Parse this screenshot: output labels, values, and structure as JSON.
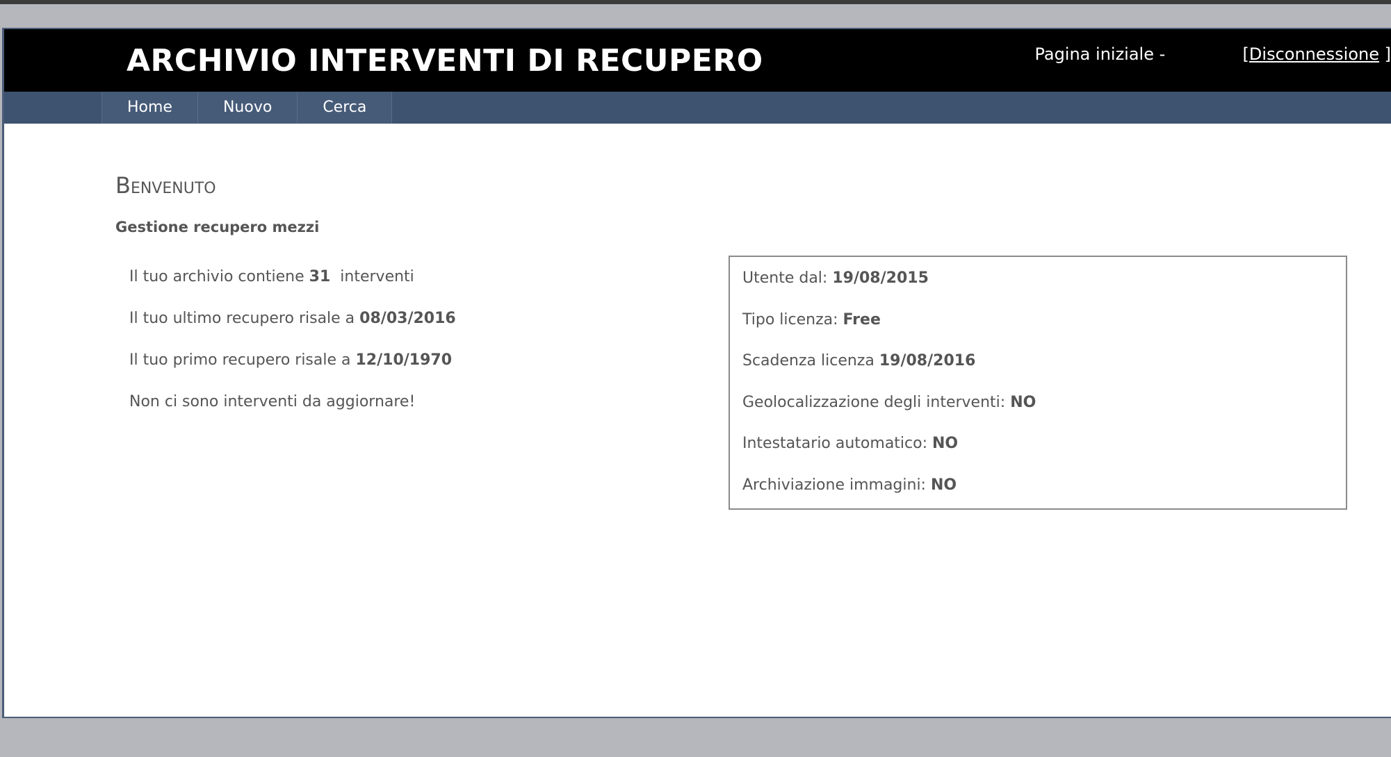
{
  "header": {
    "title": "ARCHIVIO INTERVENTI DI RECUPERO",
    "home_label": "Pagina iniziale -",
    "logout_open": "[",
    "logout_label": "Disconnessione",
    "logout_close": "]"
  },
  "menu": {
    "items": [
      {
        "label": "Home"
      },
      {
        "label": "Nuovo"
      },
      {
        "label": "Cerca"
      }
    ]
  },
  "main": {
    "welcome": "Benvenuto",
    "subtitle": "Gestione recupero mezzi",
    "stats": {
      "archive_prefix": "Il tuo archivio contiene",
      "archive_count": "31",
      "archive_suffix": "interventi",
      "last_prefix": "Il tuo ultimo recupero risale a",
      "last_date": "08/03/2016",
      "first_prefix": "Il tuo primo recupero risale a",
      "first_date": "12/10/1970",
      "no_updates": "Non ci sono interventi da aggiornare!"
    },
    "license": {
      "user_since_label": "Utente dal:",
      "user_since_value": "19/08/2015",
      "type_label": "Tipo licenza:",
      "type_value": "Free",
      "expiry_label": "Scadenza licenza",
      "expiry_value": "19/08/2016",
      "geo_label": "Geolocalizzazione degli interventi:",
      "geo_value": "NO",
      "holder_label": "Intestatario automatico:",
      "holder_value": "NO",
      "images_label": "Archiviazione immagini:",
      "images_value": "NO"
    }
  }
}
